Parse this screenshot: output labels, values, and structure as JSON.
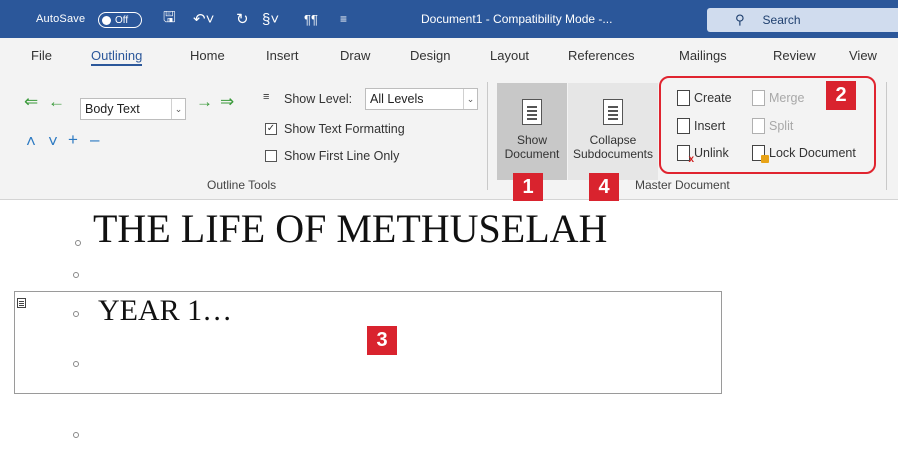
{
  "titlebar": {
    "autosave_label": "AutoSave",
    "autosave_state": "Off",
    "document_title": "Document1 - Compatibility Mode -...",
    "search_label": "Search",
    "bg_color": "#2b579a"
  },
  "tabs": [
    "File",
    "Outlining",
    "Home",
    "Insert",
    "Draw",
    "Design",
    "Layout",
    "References",
    "Mailings",
    "Review",
    "View"
  ],
  "active_tab": "Outlining",
  "outline_tools": {
    "level_value": "Body Text",
    "show_level_label": "Show Level:",
    "show_level_value": "All Levels",
    "show_text_formatting": "Show Text Formatting",
    "show_text_formatting_checked": true,
    "show_first_line_only": "Show First Line Only",
    "show_first_line_only_checked": false,
    "group_label": "Outline Tools"
  },
  "master_document": {
    "show_document_line1": "Show",
    "show_document_line2": "Document",
    "collapse_line1": "Collapse",
    "collapse_line2": "Subdocuments",
    "create": "Create",
    "merge": "Merge",
    "insert": "Insert",
    "split": "Split",
    "unlink": "Unlink",
    "lock_document": "Lock Document",
    "group_label": "Master Document"
  },
  "callouts": {
    "one": "1",
    "two": "2",
    "three": "3",
    "four": "4",
    "color": "#d9232e"
  },
  "document": {
    "heading1": "THE LIFE OF METHUSELAH",
    "heading2": "YEAR 1…"
  }
}
